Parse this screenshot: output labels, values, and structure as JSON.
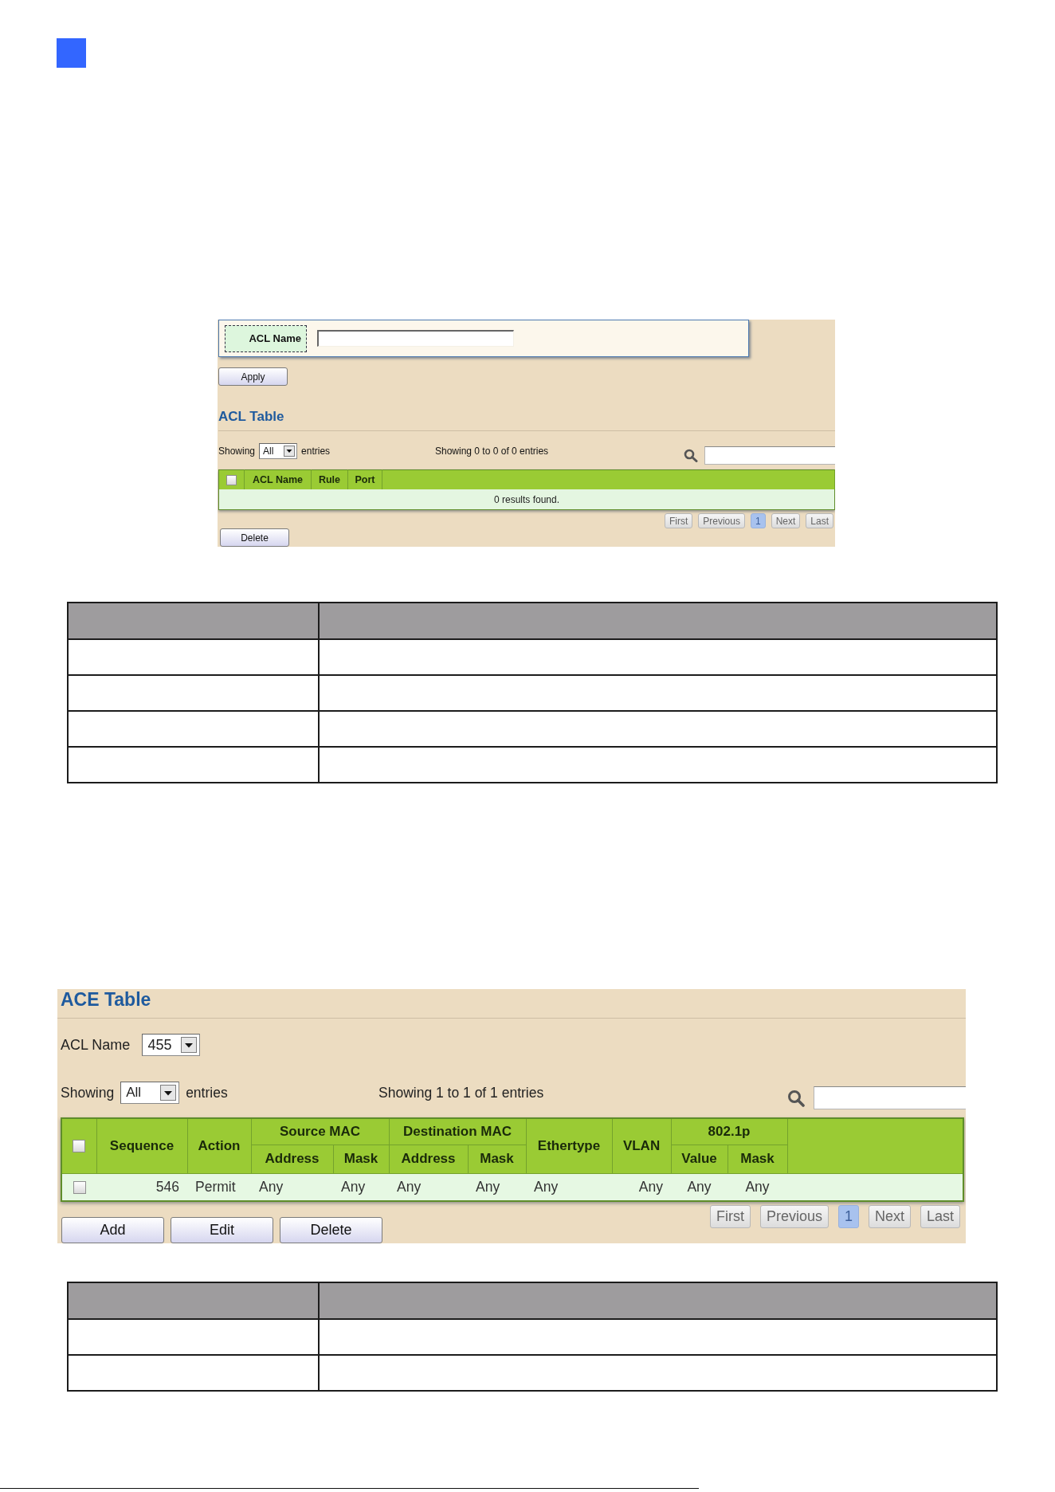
{
  "acl_form": {
    "field_label": "ACL Name",
    "apply_button": "Apply"
  },
  "acl_table": {
    "title": "ACL Table",
    "showing_label": "Showing",
    "page_size": "All",
    "entries_label": "entries",
    "summary": "Showing 0 to 0 of 0 entries",
    "columns": [
      {
        "kind": "checkbox",
        "checked": false
      },
      {
        "kind": "text",
        "label": "ACL Name"
      },
      {
        "kind": "text",
        "label": "Rule"
      },
      {
        "kind": "text",
        "label": "Port"
      },
      {
        "kind": "blank"
      }
    ],
    "empty_message": "0 results found.",
    "pagination": [
      {
        "label": "First",
        "selected": false
      },
      {
        "label": "Previous",
        "selected": false
      },
      {
        "label": "1",
        "selected": true
      },
      {
        "label": "Next",
        "selected": false
      },
      {
        "label": "Last",
        "selected": false
      }
    ],
    "delete_button": "Delete"
  },
  "table_1": {
    "columns": [
      {
        "kind": "blank"
      },
      {
        "kind": "blank"
      }
    ],
    "rows": [
      {
        "kind": "blank"
      },
      {
        "kind": "blank"
      },
      {
        "kind": "blank"
      },
      {
        "kind": "blank"
      }
    ]
  },
  "ace_table": {
    "title": "ACE Table",
    "acl_name_label": "ACL Name",
    "acl_name_value": "455",
    "showing_label": "Showing",
    "page_size": "All",
    "entries_label": "entries",
    "summary": "Showing 1 to 1 of 1 entries",
    "columns": [
      {
        "kind": "checkbox",
        "checked": false
      },
      {
        "kind": "text",
        "label": "Sequence"
      },
      {
        "kind": "text",
        "label": "Action"
      },
      {
        "kind": "group",
        "label": "Source MAC",
        "colspan": 2,
        "children": [
          {
            "label": "Address"
          },
          {
            "label": "Mask"
          }
        ]
      },
      {
        "kind": "group",
        "label": "Destination MAC",
        "colspan": 2,
        "children": [
          {
            "label": "Address"
          },
          {
            "label": "Mask"
          }
        ]
      },
      {
        "kind": "text",
        "label": "Ethertype"
      },
      {
        "kind": "text",
        "label": "VLAN"
      },
      {
        "kind": "group",
        "label": "802.1p",
        "colspan": 2,
        "children": [
          {
            "label": "Value"
          },
          {
            "label": "Mask"
          }
        ]
      },
      {
        "kind": "blank"
      }
    ],
    "rows": [
      {
        "cells": [
          {
            "kind": "checkbox",
            "checked": false
          },
          {
            "kind": "text",
            "text": "546"
          },
          {
            "kind": "text",
            "text": "Permit"
          },
          {
            "kind": "text",
            "text": "Any"
          },
          {
            "kind": "text",
            "text": "Any"
          },
          {
            "kind": "text",
            "text": "Any"
          },
          {
            "kind": "text",
            "text": "Any"
          },
          {
            "kind": "text",
            "text": "Any"
          },
          {
            "kind": "text",
            "text": "Any"
          },
          {
            "kind": "text",
            "text": "Any"
          },
          {
            "kind": "text",
            "text": "Any"
          },
          {
            "kind": "blank"
          }
        ]
      }
    ],
    "pagination": [
      {
        "label": "First",
        "selected": false
      },
      {
        "label": "Previous",
        "selected": false
      },
      {
        "label": "1",
        "selected": true
      },
      {
        "label": "Next",
        "selected": false
      },
      {
        "label": "Last",
        "selected": false
      }
    ],
    "buttons": [
      "Add",
      "Edit",
      "Delete"
    ]
  },
  "table_2": {
    "columns": [
      {
        "kind": "blank"
      },
      {
        "kind": "blank"
      }
    ],
    "rows": [
      {
        "kind": "blank"
      },
      {
        "kind": "blank"
      }
    ]
  }
}
